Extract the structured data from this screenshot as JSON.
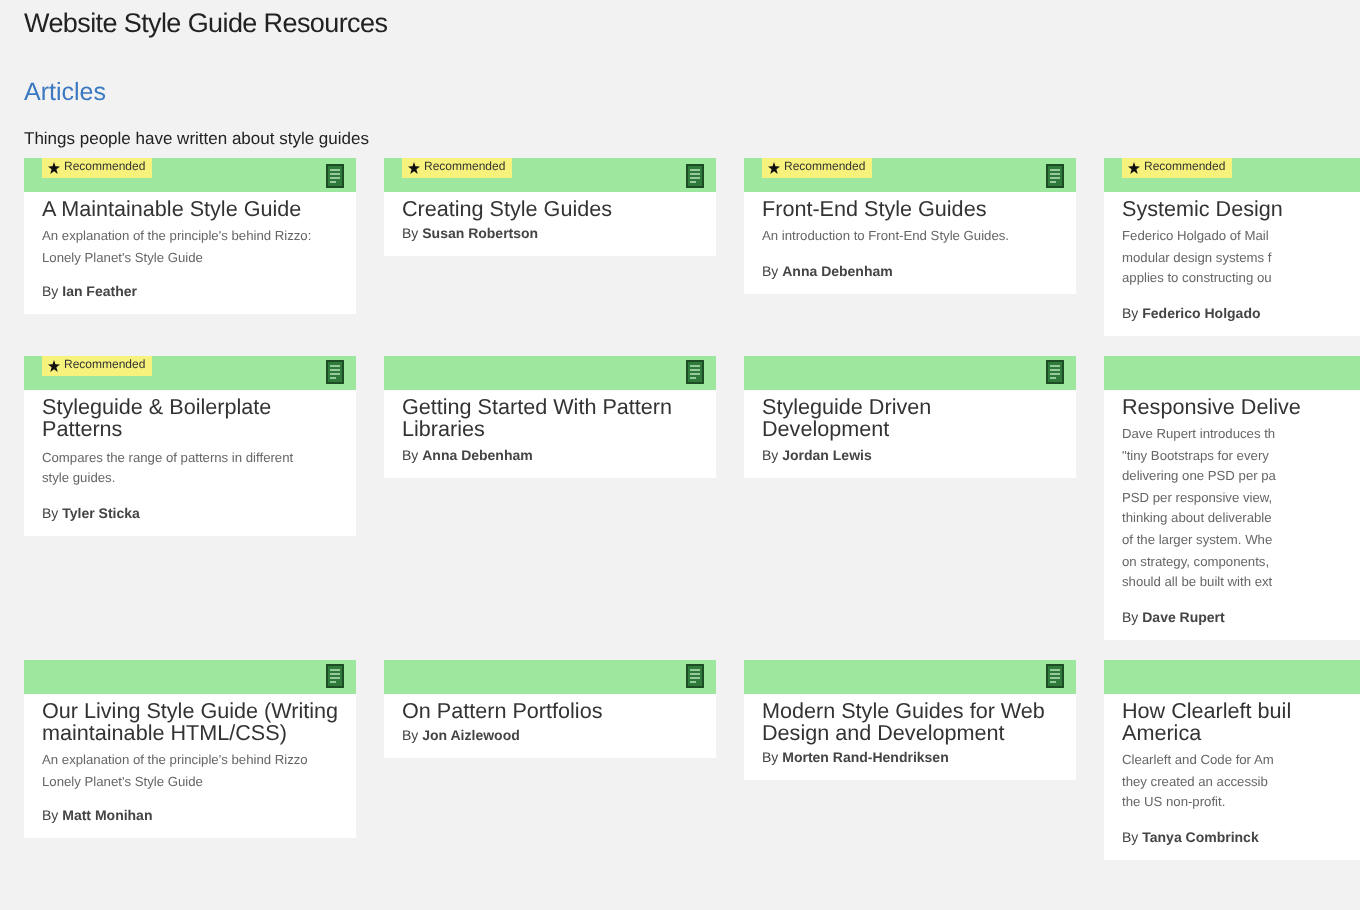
{
  "page_title": "Website Style Guide Resources",
  "section": {
    "heading": "Articles",
    "intro": "Things people have written about style guides"
  },
  "cards": [
    {
      "recommended": true,
      "tag": "Recommended",
      "title": "A Maintainable Style Guide",
      "description_lines": [
        "An explanation of the principle's behind Rizzo:",
        "Lonely Planet's Style Guide"
      ],
      "author": "By **Ian Feather**"
    },
    {
      "recommended": true,
      "tag": "Recommended",
      "title": "Creating Style Guides",
      "author": "By **Susan Robertson**"
    },
    {
      "recommended": true,
      "tag": "Recommended",
      "title": "Front-End Style Guides",
      "description_lines": [
        "An introduction to Front-End Style Guides."
      ],
      "author": "By **Anna Debenham**"
    },
    {
      "recommended": true,
      "tag": "Recommended",
      "title": "Systemic Design",
      "description_lines": [
        "Federico Holgado of Mail",
        "modular design systems f",
        "applies to constructing ou"
      ],
      "author": "By **Federico Holgado**"
    },
    {
      "recommended": true,
      "tag": "Recommended",
      "title": "Styleguide & Boilerplate Patterns",
      "description_lines": [
        "Compares the range of patterns in different",
        "style guides."
      ],
      "author": "By **Tyler Sticka**"
    },
    {
      "recommended": false,
      "title": "Getting Started With Pattern Libraries",
      "author": "By **Anna Debenham**"
    },
    {
      "recommended": false,
      "title": "Styleguide Driven Development",
      "author": "By **Jordan Lewis**"
    },
    {
      "recommended": false,
      "title": "Responsive Delive",
      "description_lines": [
        "Dave Rupert introduces th",
        "\"tiny Bootstraps for every",
        "delivering one PSD per pa",
        "PSD per responsive view,",
        "thinking about deliverable",
        "of the larger system. Whe",
        "on strategy, components,",
        "should all be built with ext"
      ],
      "author": "By **Dave Rupert**"
    },
    {
      "recommended": false,
      "title": "Our Living Style Guide (Writing maintainable HTML/CSS)",
      "description_lines": [
        "An explanation of the principle's behind Rizzo",
        "Lonely Planet's Style Guide"
      ],
      "author": "By **Matt Monihan**"
    },
    {
      "recommended": false,
      "title": "On Pattern Portfolios",
      "author": "By **Jon Aizlewood**"
    },
    {
      "recommended": false,
      "title": "Modern Style Guides for Web Design and Development",
      "author": "By **Morten Rand-Hendriksen**"
    },
    {
      "recommended": false,
      "title": "How Clearleft buil America",
      "description_lines": [
        "Clearleft and Code for Am",
        "they created an accessib",
        "the US non-profit."
      ],
      "author": "By **Tanya Combrinck**"
    }
  ]
}
